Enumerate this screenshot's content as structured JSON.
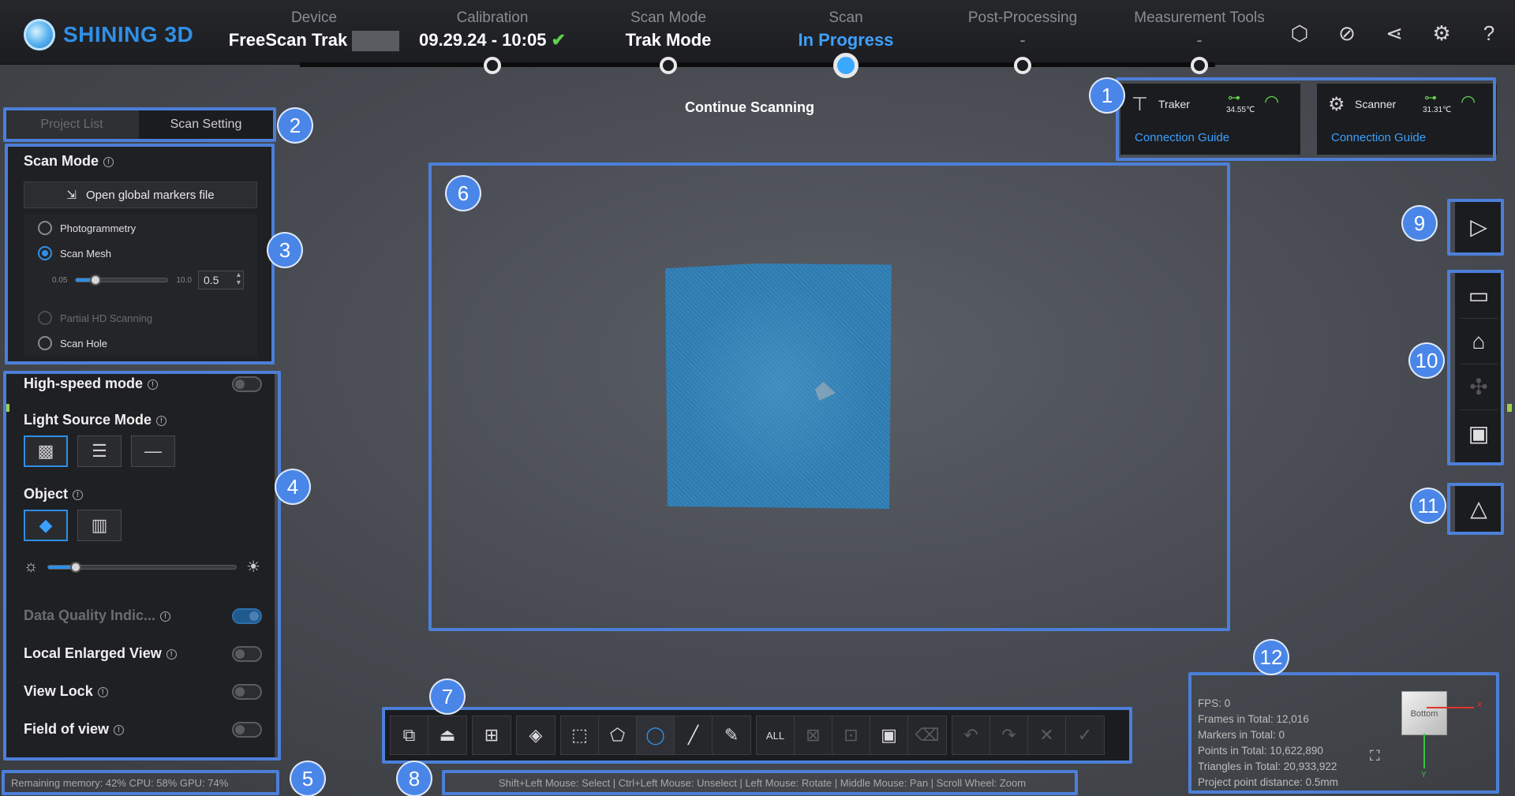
{
  "app": {
    "brand": "SHINING 3D"
  },
  "steps": [
    {
      "label": "Device",
      "value": "FreeScan Trak"
    },
    {
      "label": "Calibration",
      "value": "09.29.24 - 10:05",
      "check": "✔"
    },
    {
      "label": "Scan Mode",
      "value": "Trak Mode"
    },
    {
      "label": "Scan",
      "value": "In Progress"
    },
    {
      "label": "Post-Processing",
      "value": "-"
    },
    {
      "label": "Measurement Tools",
      "value": "-"
    }
  ],
  "header_icons": [
    "model-icon",
    "link-icon",
    "share-icon",
    "settings-icon",
    "help-icon"
  ],
  "panel": {
    "tabs": [
      "Project List",
      "Scan Setting"
    ],
    "scan_mode": {
      "title": "Scan Mode",
      "open_markers": "Open global markers file",
      "options": [
        "Photogrammetry",
        "Scan Mesh",
        "Partial HD Scanning",
        "Scan Hole"
      ],
      "selected": "Scan Mesh",
      "min": "0.05",
      "max": "10.0",
      "value": "0.5"
    },
    "settings": {
      "high_speed": "High-speed mode",
      "light_source": "Light Source Mode",
      "object": "Object",
      "data_quality": "Data Quality Indic...",
      "local_enlarged": "Local Enlarged View",
      "view_lock": "View Lock",
      "field_of_view": "Field of view"
    }
  },
  "status": {
    "resources": "Remaining memory: 42% CPU: 58% GPU: 74%",
    "mouse_hints": "Shift+Left Mouse: Select | Ctrl+Left Mouse: Unselect | Left Mouse: Rotate | Middle Mouse: Pan | Scroll Wheel: Zoom"
  },
  "center": {
    "hint": "Continue Scanning"
  },
  "connection": [
    {
      "name": "Traker",
      "temp": "34.55℃",
      "guide": "Connection Guide"
    },
    {
      "name": "Scanner",
      "temp": "31.31℃",
      "guide": "Connection Guide"
    }
  ],
  "stats": {
    "fps": "FPS: 0",
    "frames": "Frames in Total: 12,016",
    "markers": "Markers in Total: 0",
    "points": "Points in Total: 10,622,890",
    "triangles": "Triangles in Total: 20,933,922",
    "distance": "Project point distance: 0.5mm",
    "cube_face": "Bottom"
  },
  "annotations": [
    "1",
    "2",
    "3",
    "4",
    "5",
    "6",
    "7",
    "8",
    "9",
    "10",
    "11",
    "12"
  ],
  "colors": {
    "accent": "#2f8fe6",
    "annotation": "#4c7fd8",
    "ok": "#5fd14a",
    "mesh": "#2f7fb6"
  }
}
